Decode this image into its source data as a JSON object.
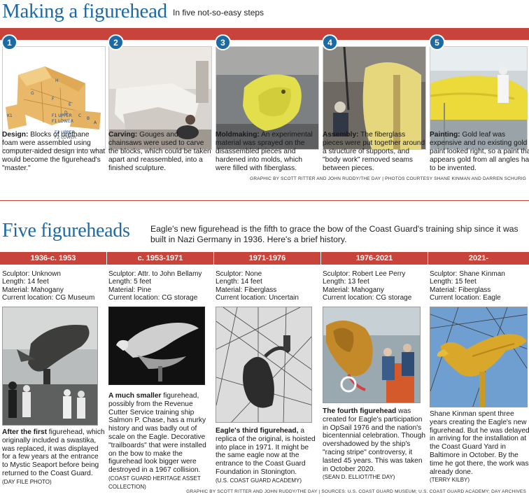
{
  "header": {
    "title": "Making a figurehead",
    "subtitle": "In five not-so-easy steps"
  },
  "steps": [
    {
      "num": "1",
      "label": "Design:",
      "text": " Blocks of urethane foam were assembled using computer-aided design into what would become the figurehead's \"master.\"",
      "diagram_labels": [
        "H",
        "G",
        "F",
        "E",
        "C",
        "D",
        "B",
        "A",
        "F1 UPPER",
        "F1 LOWER",
        "F2 UPPER",
        "F2 LOWER",
        "K1"
      ]
    },
    {
      "num": "2",
      "label": "Carving:",
      "text": " Gouges and chainsaws were used to carve the blocks, which could be taken apart and reassembled, into a finished sculpture."
    },
    {
      "num": "3",
      "label": "Moldmaking:",
      "text": " An experimental material was sprayed on the disassembled pieces and hardened into molds, which were filled with fiberglass."
    },
    {
      "num": "4",
      "label": "Assembly:",
      "text": " The fiberglass pieces were put together around a structure of supports, and \"body work\" removed seams between pieces."
    },
    {
      "num": "5",
      "label": "Painting:",
      "text": " Gold leaf was expensive and no existing gold paint looked right, so a paint that appears gold from all angles had to be invented."
    }
  ],
  "credit_top": "GRAPHIC BY SCOTT RITTER AND JOHN RUDDY/THE DAY | PHOTOS COURTESY SHANE KINMAN AND DARREN SCHURIG",
  "section2": {
    "title": "Five figureheads",
    "intro": "Eagle's new figurehead is the fifth to grace the bow of the Coast Guard's training ship since it was built in Nazi Germany in 1936. Here's a brief history."
  },
  "figureheads": [
    {
      "era": "1936-c. 1953",
      "facts": [
        "Sculptor: Unknown",
        "Length: 14 feet",
        "Material: Mahogany",
        "Current location: CG Museum"
      ],
      "lead": "After the first",
      "caption": " figurehead, which originally included a swastika, was replaced, it was displayed for a few years at the entrance to Mystic Seaport before being returned to the Coast Guard.",
      "source": "(DAY FILE PHOTO)"
    },
    {
      "era": "c. 1953-1971",
      "facts": [
        "Sculptor: Attr. to John Bellamy",
        "Length: 5 feet",
        "Material: Pine",
        "Current location: CG storage"
      ],
      "lead": "A much smaller",
      "caption": " figurehead, possibly from the Revenue Cutter Service training ship Salmon P. Chase, has a murky history and was badly out of scale on the Eagle. Decorative \"trailboards\" that were installed on the bow to make the figurehead look bigger were destroyed in a 1967 collision.",
      "source": "(COAST GUARD HERITAGE ASSET COLLECTION)"
    },
    {
      "era": "1971-1976",
      "facts": [
        "Sculptor: None",
        "Length: 14 feet",
        "Material: Fiberglass",
        "Current location: Uncertain"
      ],
      "lead": "Eagle's third figurehead,",
      "caption": " a replica of the original, is hoisted into place in 1971. It might be the same eagle now at the entrance to the Coast Guard Foundation in Stonington.",
      "source": "(U.S. COAST GUARD ACADEMY)"
    },
    {
      "era": "1976-2021",
      "facts": [
        "Sculptor: Robert Lee Perry",
        "Length: 13 feet",
        "Material: Mahogany",
        "Current location: CG storage"
      ],
      "lead": "The fourth figurehead",
      "caption": " was created for Eagle's participation in OpSail 1976 and the nation's bicentennial celebration. Though overshadowed by the ship's \"racing stripe\" controversy, it lasted 45 years. This was taken in October 2020.",
      "source": "(SEAN D. ELLIOT/THE DAY)"
    },
    {
      "era": "2021-",
      "facts": [
        "Sculptor: Shane Kinman",
        "Length: 15 feet",
        "Material: Fiberglass",
        "Current location: Eagle"
      ],
      "lead": "",
      "caption": "Shane Kinman spent three years creating the Eagle's new figurehead. But he was delayed in arriving for the installation at the Coast Guard Yard in Baltimore in October. By the time he got there, the work was already done.",
      "source": "(TERRY KILBY)"
    }
  ],
  "credit_bottom": "GRAPHIC BY SCOTT RITTER AND JOHN RUDDY/THE DAY | SOURCES: U.S. COAST GUARD MUSEUM; U.S. COAST GUARD ACADEMY; DAY ARCHIVES",
  "colors": {
    "accent_blue": "#1c6aa5",
    "bar_red": "#c8433a"
  }
}
